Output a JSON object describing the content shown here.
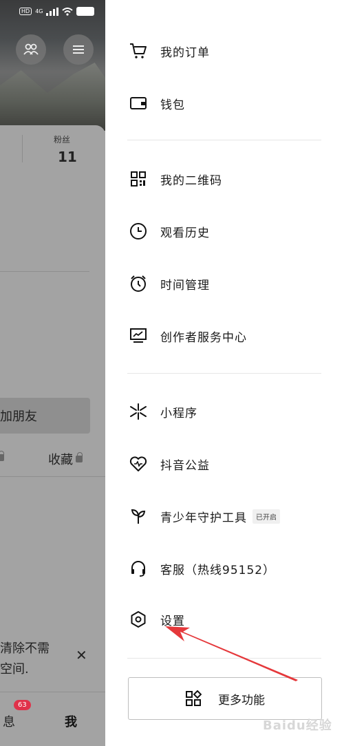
{
  "status_bar": {
    "hd": "HD",
    "net": "4G"
  },
  "background": {
    "fans_label": "粉丝",
    "fans_count": "11",
    "add_friend": "加朋友",
    "favorites": "收藏",
    "tip_text": "清除不需要空间。",
    "tip_line1": "清除不需",
    "tip_line2": "空间.",
    "nav_message": "息",
    "nav_badge": "63",
    "nav_me": "我"
  },
  "drawer": {
    "orders": "我的订单",
    "wallet": "钱包",
    "qrcode": "我的二维码",
    "history": "观看历史",
    "time_mgmt": "时间管理",
    "creator_center": "创作者服务中心",
    "mini_program": "小程序",
    "charity": "抖音公益",
    "youth_tool": "青少年守护工具",
    "youth_tag": "已开启",
    "customer_service": "客服（热线95152）",
    "settings": "设置",
    "more_functions": "更多功能"
  },
  "annotation": {
    "arrow_color": "#e5383b"
  },
  "watermark": "Baidu经验"
}
